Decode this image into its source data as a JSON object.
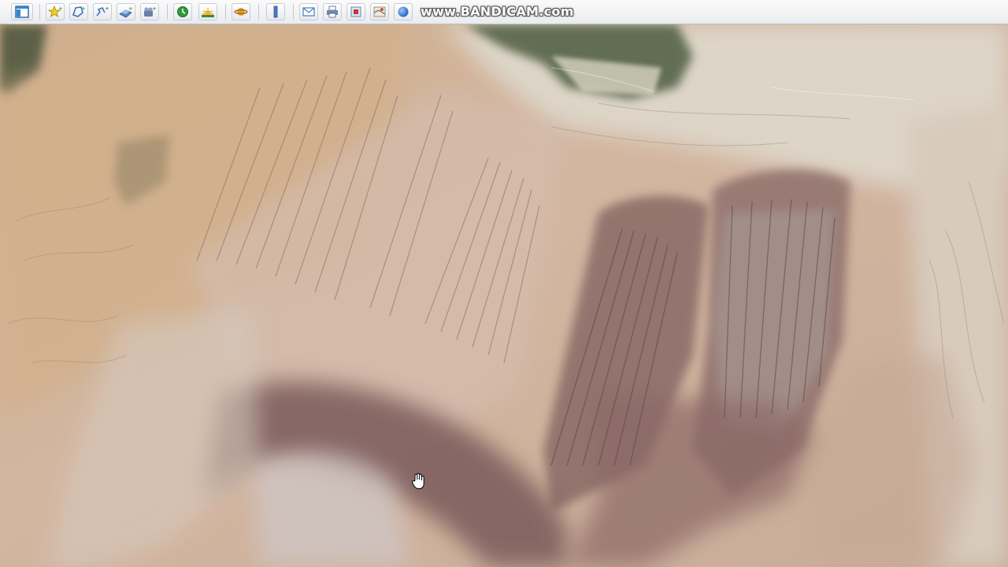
{
  "toolbar": {
    "buttons": [
      {
        "icon": "sidebar-toggle-icon"
      },
      {
        "icon": "add-placemark-icon"
      },
      {
        "icon": "add-polygon-icon"
      },
      {
        "icon": "add-path-icon"
      },
      {
        "icon": "add-image-overlay-icon"
      },
      {
        "icon": "record-tour-icon"
      },
      {
        "icon": "historical-imagery-icon"
      },
      {
        "icon": "sunlight-icon"
      },
      {
        "icon": "switch-to-sky-icon"
      },
      {
        "icon": "ruler-icon"
      },
      {
        "icon": "email-icon"
      },
      {
        "icon": "print-icon"
      },
      {
        "icon": "save-image-icon"
      },
      {
        "icon": "view-in-maps-icon"
      },
      {
        "icon": "earth-icon"
      }
    ]
  },
  "recording_watermark": "www.BANDICAM.com",
  "colors": {
    "toolbar_bg": "#eef0f3",
    "terrain_base": "#cdb39c",
    "terrain_dark": "#7d5f5a",
    "terrain_light": "#ded4c6",
    "vegetation": "#4a5a40"
  },
  "imagery": {
    "description_icon": "satellite-terrain-image"
  },
  "cursor": {
    "icon": "hand-grab-icon"
  }
}
